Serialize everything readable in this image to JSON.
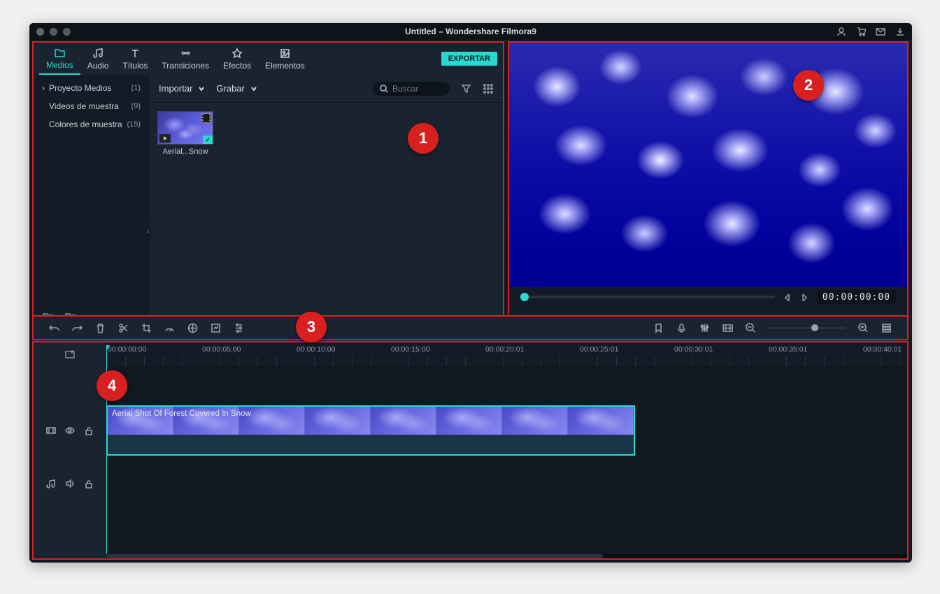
{
  "title": "Untitled – Wondershare Filmora9",
  "tabs": {
    "medios": "Medios",
    "audio": "Audio",
    "titulos": "Títulos",
    "transiciones": "Transiciones",
    "efectos": "Efectos",
    "elementos": "Elementos"
  },
  "export": "EXPORTAR",
  "sidebar": {
    "proyecto": "Proyecto Medios",
    "proyecto_count": "(1)",
    "videos": "Videos de muestra",
    "videos_count": "(9)",
    "colores": "Colores de muestra",
    "colores_count": "(15)"
  },
  "mediaToolbar": {
    "importar": "Importar",
    "grabar": "Grabar",
    "search_placeholder": "Buscar"
  },
  "thumb": {
    "label": "Aerial...Snow"
  },
  "preview": {
    "timecode": "00:00:00:00"
  },
  "ruler": [
    "00:00:00:00",
    "00:00:05:00",
    "00:00:10:00",
    "00:00:15:00",
    "00:00:20:01",
    "00:00:25:01",
    "00:00:30:01",
    "00:00:35:01",
    "00:00:40:01"
  ],
  "clip": {
    "label": "Aerial Shot Of Forest Covered In Snow"
  },
  "badges": {
    "b1": "1",
    "b2": "2",
    "b3": "3",
    "b4": "4"
  }
}
